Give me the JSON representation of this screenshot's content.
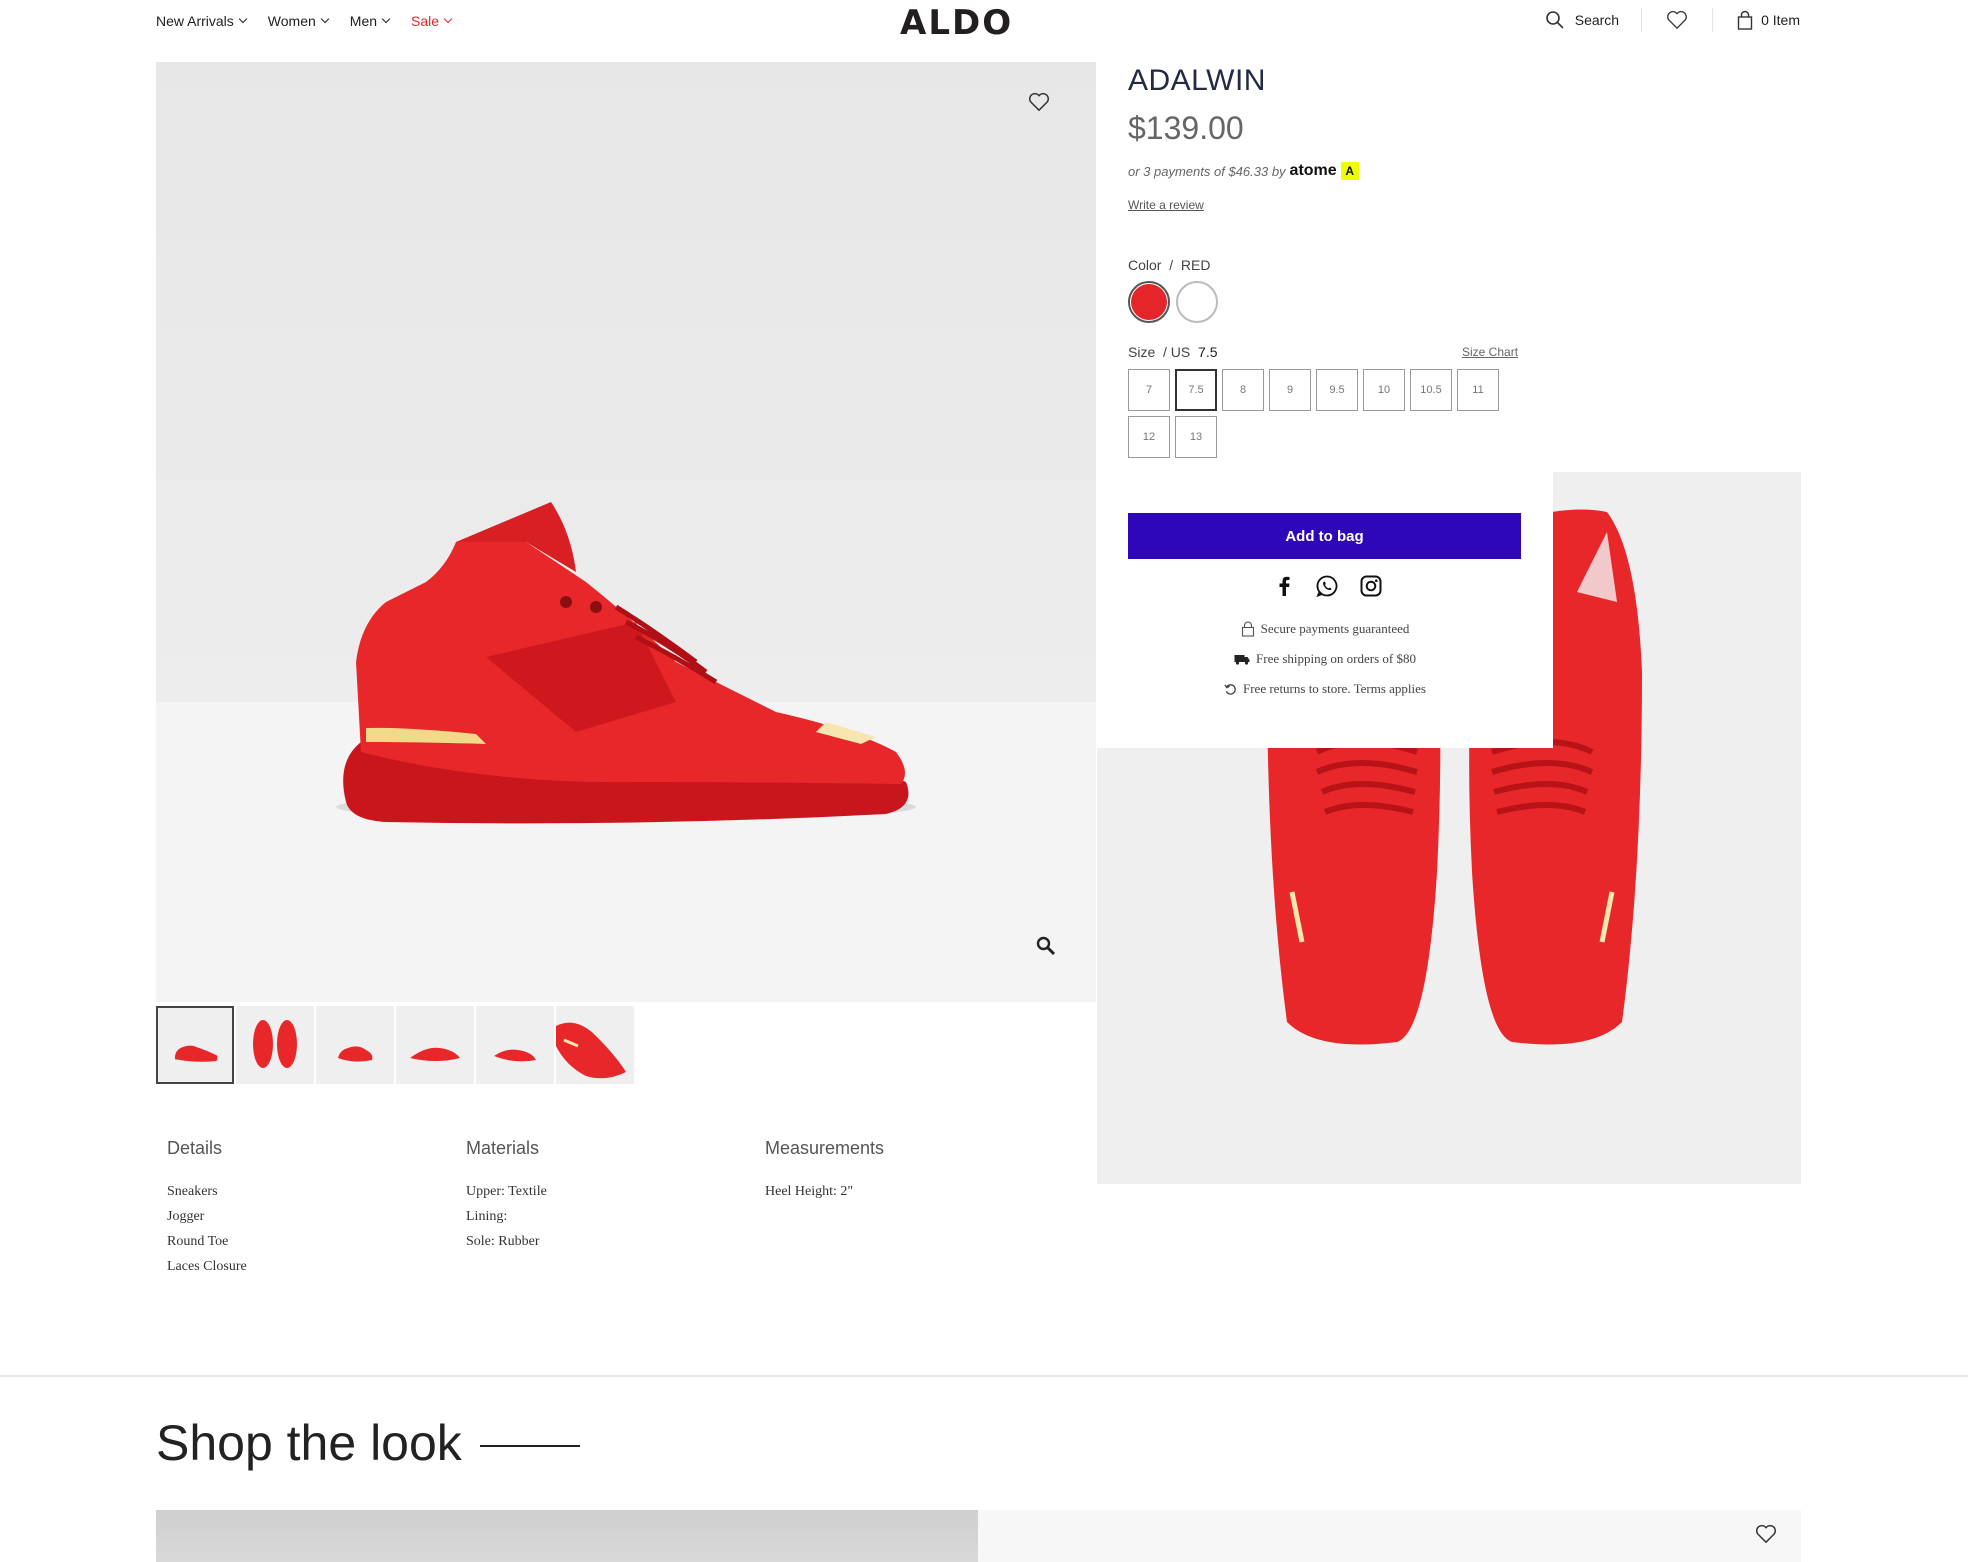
{
  "header": {
    "nav": [
      {
        "label": "New Arrivals"
      },
      {
        "label": "Women"
      },
      {
        "label": "Men"
      },
      {
        "label": "Sale"
      }
    ],
    "logo": "ALDO",
    "search_label": "Search",
    "bag_label": "0 Item"
  },
  "product": {
    "name": "ADALWIN",
    "price": "$139.00",
    "installment_text": "or 3 payments of $46.33 by",
    "installment_brand": "atome",
    "review_link": "Write a review",
    "color_label": "Color",
    "color_separator": "/",
    "color_value": "RED",
    "colors": [
      "#e4262b",
      "#ffffff"
    ],
    "size_label": "Size",
    "size_unit": "/ US",
    "size_value": "7.5",
    "size_chart": "Size Chart",
    "sizes": [
      "7",
      "7.5",
      "8",
      "9",
      "9.5",
      "10",
      "10.5",
      "11",
      "12",
      "13"
    ],
    "selected_size": "7.5",
    "add_to_bag": "Add to bag",
    "perks": [
      "Secure payments guaranteed",
      "Free shipping on orders of $80",
      "Free returns to store. Terms applies"
    ]
  },
  "details": [
    {
      "title": "Details",
      "items": [
        "Sneakers",
        "Jogger",
        "Round Toe",
        "Laces Closure"
      ]
    },
    {
      "title": "Materials",
      "items": [
        "Upper: Textile",
        "Lining:",
        "Sole: Rubber"
      ]
    },
    {
      "title": "Measurements",
      "items": [
        "Heel Height: 2\""
      ]
    }
  ],
  "shop_the_look": "Shop the look",
  "colors": {
    "accent": "#2e08b8",
    "sale": "#e4262b",
    "shoe": "#e8272a"
  }
}
